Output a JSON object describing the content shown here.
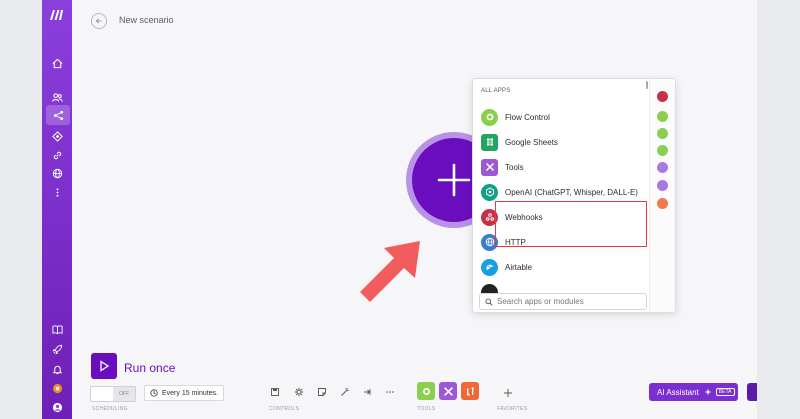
{
  "header": {
    "title": "New scenario"
  },
  "app_panel": {
    "heading": "ALL APPS",
    "items": [
      {
        "label": "Flow Control",
        "icon": "gear-icon",
        "color": "#8ccf4f"
      },
      {
        "label": "Google Sheets",
        "icon": "sheets-icon",
        "color": "#21a464"
      },
      {
        "label": "Tools",
        "icon": "tools-icon",
        "color": "#9b59d6"
      },
      {
        "label": "OpenAI (ChatGPT, Whisper, DALL-E)",
        "icon": "openai-icon",
        "color": "#14a085"
      },
      {
        "label": "Webhooks",
        "icon": "webhooks-icon",
        "color": "#c8304a"
      },
      {
        "label": "HTTP",
        "icon": "http-icon",
        "color": "#3a7bd5"
      },
      {
        "label": "Airtable",
        "icon": "airtable-icon",
        "color": "#18a0e0"
      }
    ],
    "search_placeholder": "Search apps or modules"
  },
  "run": {
    "label": "Run once"
  },
  "scheduling": {
    "toggle_state": "OFF",
    "interval": "Every 15 minutes.",
    "section_label": "SCHEDULING"
  },
  "controls": {
    "section_label": "CONTROLS"
  },
  "tools": {
    "section_label": "TOOLS"
  },
  "favorites": {
    "section_label": "FAVORITES"
  },
  "ai_assistant": {
    "label": "AI Assistant",
    "badge": "BETA"
  },
  "colors": {
    "brand": "#6a0dbf",
    "highlight": "#e03d3d",
    "arrow": "#f25c5c"
  }
}
